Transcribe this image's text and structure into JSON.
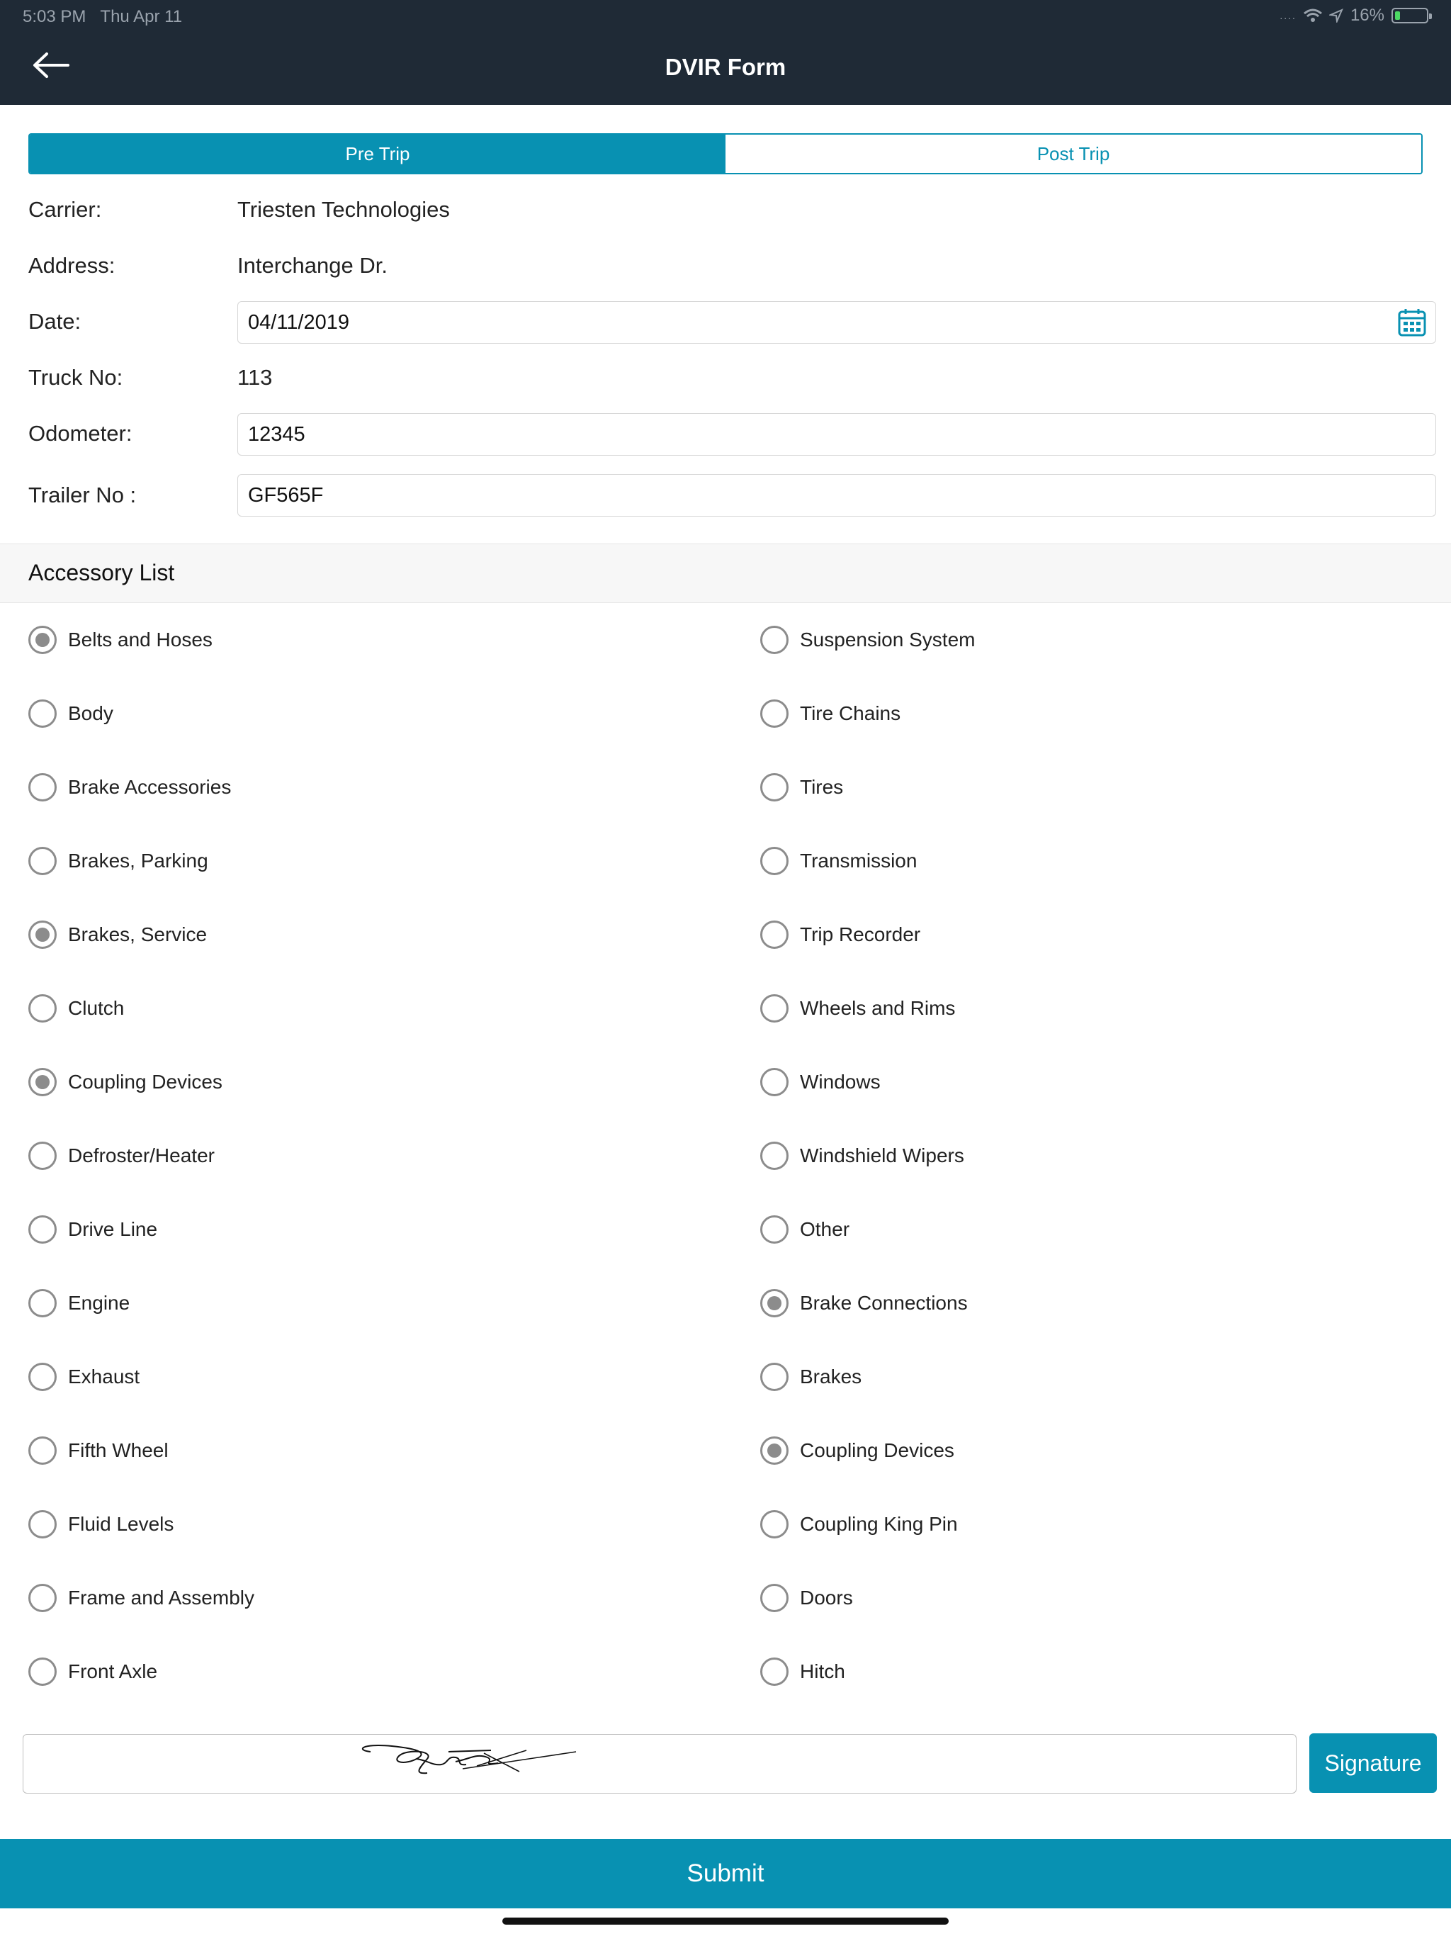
{
  "status_bar": {
    "time": "5:03 PM",
    "date": "Thu Apr 11",
    "battery": "16%",
    "battery_level": 0.16,
    "icons": [
      "signal-dots-icon",
      "wifi-icon",
      "location-arrow-icon",
      "battery-icon"
    ]
  },
  "header": {
    "title": "DVIR Form",
    "back_icon": "arrow-left-icon"
  },
  "tabs": [
    {
      "label": "Pre Trip",
      "active": true
    },
    {
      "label": "Post Trip",
      "active": false
    }
  ],
  "form": {
    "carrier_label": "Carrier:",
    "carrier_value": "Triesten Technologies",
    "address_label": "Address:",
    "address_value": "Interchange Dr.",
    "date_label": "Date:",
    "date_value": "04/11/2019",
    "truck_label": "Truck No:",
    "truck_value": "113",
    "odometer_label": "Odometer:",
    "odometer_value": "12345",
    "trailer_label": "Trailer No :",
    "trailer_value": "GF565F"
  },
  "accessory": {
    "title": "Accessory List",
    "left": [
      {
        "label": "Belts and Hoses",
        "checked": true
      },
      {
        "label": "Body",
        "checked": false
      },
      {
        "label": "Brake Accessories",
        "checked": false
      },
      {
        "label": "Brakes, Parking",
        "checked": false
      },
      {
        "label": "Brakes, Service",
        "checked": true
      },
      {
        "label": "Clutch",
        "checked": false
      },
      {
        "label": "Coupling Devices",
        "checked": true
      },
      {
        "label": "Defroster/Heater",
        "checked": false
      },
      {
        "label": "Drive Line",
        "checked": false
      },
      {
        "label": "Engine",
        "checked": false
      },
      {
        "label": "Exhaust",
        "checked": false
      },
      {
        "label": "Fifth Wheel",
        "checked": false
      },
      {
        "label": "Fluid Levels",
        "checked": false
      },
      {
        "label": "Frame and Assembly",
        "checked": false
      },
      {
        "label": "Front Axle",
        "checked": false
      }
    ],
    "right": [
      {
        "label": "Suspension System",
        "checked": false
      },
      {
        "label": "Tire Chains",
        "checked": false
      },
      {
        "label": "Tires",
        "checked": false
      },
      {
        "label": "Transmission",
        "checked": false
      },
      {
        "label": "Trip Recorder",
        "checked": false
      },
      {
        "label": "Wheels and Rims",
        "checked": false
      },
      {
        "label": "Windows",
        "checked": false
      },
      {
        "label": "Windshield Wipers",
        "checked": false
      },
      {
        "label": "Other",
        "checked": false
      },
      {
        "label": "Brake Connections",
        "checked": true
      },
      {
        "label": "Brakes",
        "checked": false
      },
      {
        "label": "Coupling Devices",
        "checked": true
      },
      {
        "label": "Coupling King Pin",
        "checked": false
      },
      {
        "label": "Doors",
        "checked": false
      },
      {
        "label": "Hitch",
        "checked": false
      }
    ]
  },
  "signature": {
    "button_label": "Signature"
  },
  "submit_label": "Submit",
  "colors": {
    "accent": "#0891b2",
    "header_bg": "#1f2a36"
  }
}
